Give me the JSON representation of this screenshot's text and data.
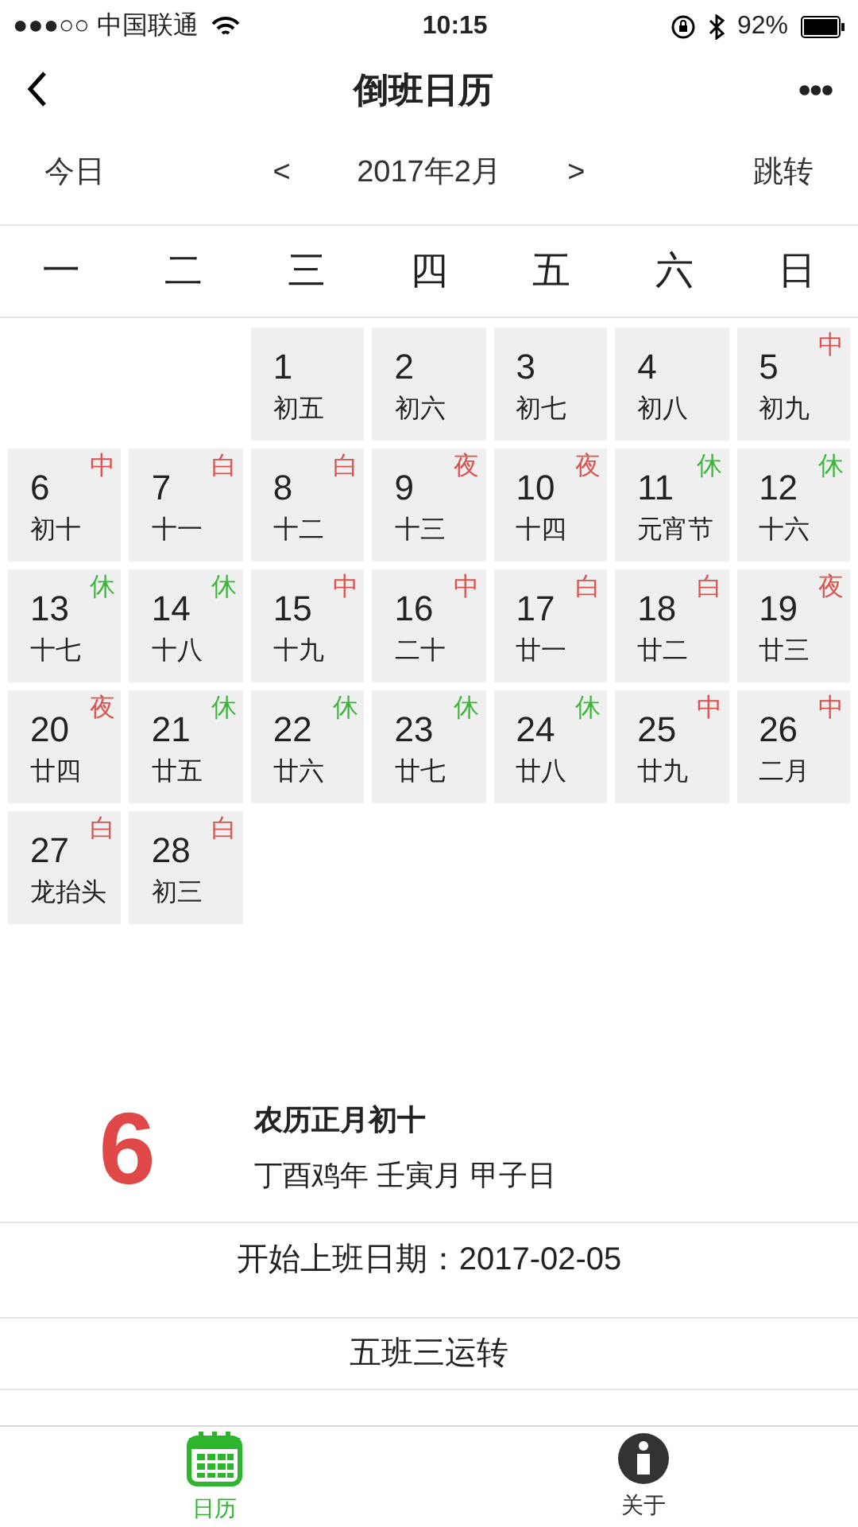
{
  "status_bar": {
    "carrier": "●●●○○ 中国联通",
    "time": "10:15",
    "battery": "92%"
  },
  "nav": {
    "title": "倒班日历",
    "more": "•••"
  },
  "toolbar": {
    "today": "今日",
    "prev": "<",
    "month": "2017年2月",
    "next": ">",
    "jump": "跳转"
  },
  "weekdays": [
    "一",
    "二",
    "三",
    "四",
    "五",
    "六",
    "日"
  ],
  "days": [
    {
      "kind": "empty"
    },
    {
      "kind": "empty"
    },
    {
      "kind": "day",
      "day": "1",
      "lunar": "初五"
    },
    {
      "kind": "day",
      "day": "2",
      "lunar": "初六"
    },
    {
      "kind": "day",
      "day": "3",
      "lunar": "初七"
    },
    {
      "kind": "day",
      "day": "4",
      "lunar": "初八"
    },
    {
      "kind": "day",
      "day": "5",
      "lunar": "初九",
      "shift": "中",
      "color": "#d9534f"
    },
    {
      "kind": "day",
      "day": "6",
      "lunar": "初十",
      "shift": "中",
      "color": "#d9534f"
    },
    {
      "kind": "day",
      "day": "7",
      "lunar": "十一",
      "shift": "白",
      "color": "#d9534f"
    },
    {
      "kind": "day",
      "day": "8",
      "lunar": "十二",
      "shift": "白",
      "color": "#d9534f"
    },
    {
      "kind": "day",
      "day": "9",
      "lunar": "十三",
      "shift": "夜",
      "color": "#d9534f"
    },
    {
      "kind": "day",
      "day": "10",
      "lunar": "十四",
      "shift": "夜",
      "color": "#d9534f"
    },
    {
      "kind": "day",
      "day": "11",
      "lunar": "元宵节",
      "shift": "休",
      "color": "#3bb53b"
    },
    {
      "kind": "day",
      "day": "12",
      "lunar": "十六",
      "shift": "休",
      "color": "#3bb53b"
    },
    {
      "kind": "day",
      "day": "13",
      "lunar": "十七",
      "shift": "休",
      "color": "#3bb53b"
    },
    {
      "kind": "day",
      "day": "14",
      "lunar": "十八",
      "shift": "休",
      "color": "#3bb53b"
    },
    {
      "kind": "day",
      "day": "15",
      "lunar": "十九",
      "shift": "中",
      "color": "#d9534f"
    },
    {
      "kind": "day",
      "day": "16",
      "lunar": "二十",
      "shift": "中",
      "color": "#d9534f"
    },
    {
      "kind": "day",
      "day": "17",
      "lunar": "廿一",
      "shift": "白",
      "color": "#d9534f"
    },
    {
      "kind": "day",
      "day": "18",
      "lunar": "廿二",
      "shift": "白",
      "color": "#d9534f"
    },
    {
      "kind": "day",
      "day": "19",
      "lunar": "廿三",
      "shift": "夜",
      "color": "#d9534f"
    },
    {
      "kind": "day",
      "day": "20",
      "lunar": "廿四",
      "shift": "夜",
      "color": "#d9534f"
    },
    {
      "kind": "day",
      "day": "21",
      "lunar": "廿五",
      "shift": "休",
      "color": "#3bb53b"
    },
    {
      "kind": "day",
      "day": "22",
      "lunar": "廿六",
      "shift": "休",
      "color": "#3bb53b"
    },
    {
      "kind": "day",
      "day": "23",
      "lunar": "廿七",
      "shift": "休",
      "color": "#3bb53b"
    },
    {
      "kind": "day",
      "day": "24",
      "lunar": "廿八",
      "shift": "休",
      "color": "#3bb53b"
    },
    {
      "kind": "day",
      "day": "25",
      "lunar": "廿九",
      "shift": "中",
      "color": "#d9534f"
    },
    {
      "kind": "day",
      "day": "26",
      "lunar": "二月",
      "shift": "中",
      "color": "#d9534f"
    },
    {
      "kind": "day",
      "day": "27",
      "lunar": "龙抬头",
      "shift": "白",
      "color": "#d9534f"
    },
    {
      "kind": "day",
      "day": "28",
      "lunar": "初三",
      "shift": "白",
      "color": "#d9534f"
    }
  ],
  "detail": {
    "day": "6",
    "lunar_date": "农历正月初十",
    "ganzhi": "丁酉鸡年 壬寅月 甲子日"
  },
  "start_date": "开始上班日期：2017-02-05",
  "rotation": "五班三运转",
  "tabs": [
    {
      "label": "日历",
      "selected": true,
      "kind": "calendar"
    },
    {
      "label": "关于",
      "selected": false,
      "kind": "info"
    }
  ]
}
